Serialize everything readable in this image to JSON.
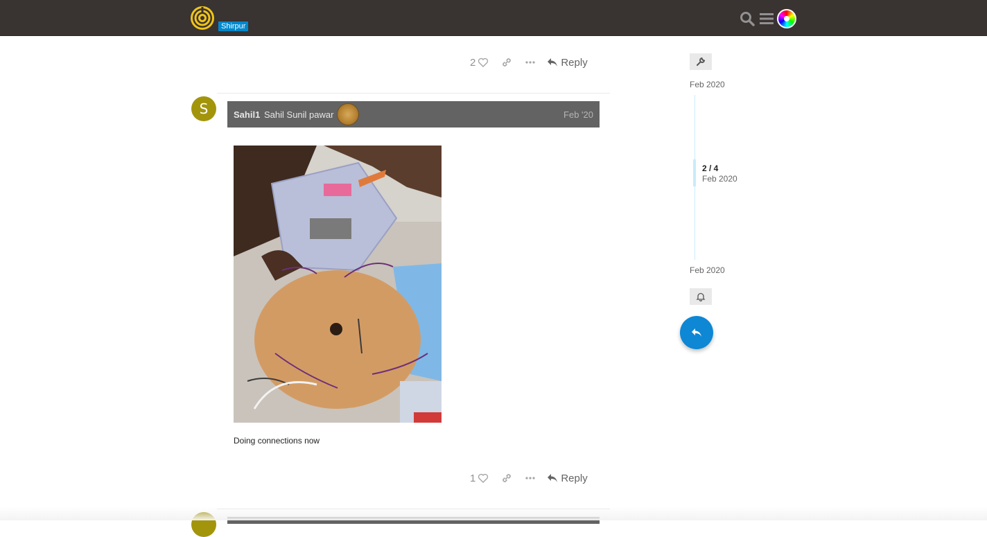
{
  "header": {
    "category_badge": "Shirpur",
    "icons": [
      "site-logo-icon",
      "search-icon",
      "hamburger-menu-icon",
      "user-avatar-icon"
    ]
  },
  "top_post_actions": {
    "like_count": "2",
    "reply_label": "Reply"
  },
  "post": {
    "avatar_letter": "S",
    "username": "Sahil1",
    "full_name": "Sahil Sunil pawar",
    "date": "Feb '20",
    "body_text": "Doing connections now",
    "like_count": "1",
    "reply_label": "Reply"
  },
  "timeline": {
    "start_date": "Feb 2020",
    "position": "2 / 4",
    "position_date": "Feb 2020",
    "end_date": "Feb 2020"
  },
  "colors": {
    "header_bg": "#393331",
    "accent": "#0088cc",
    "avatar_bg": "#a3950b",
    "meta_bar_bg": "#636363",
    "fab_bg": "#0e87d4"
  }
}
